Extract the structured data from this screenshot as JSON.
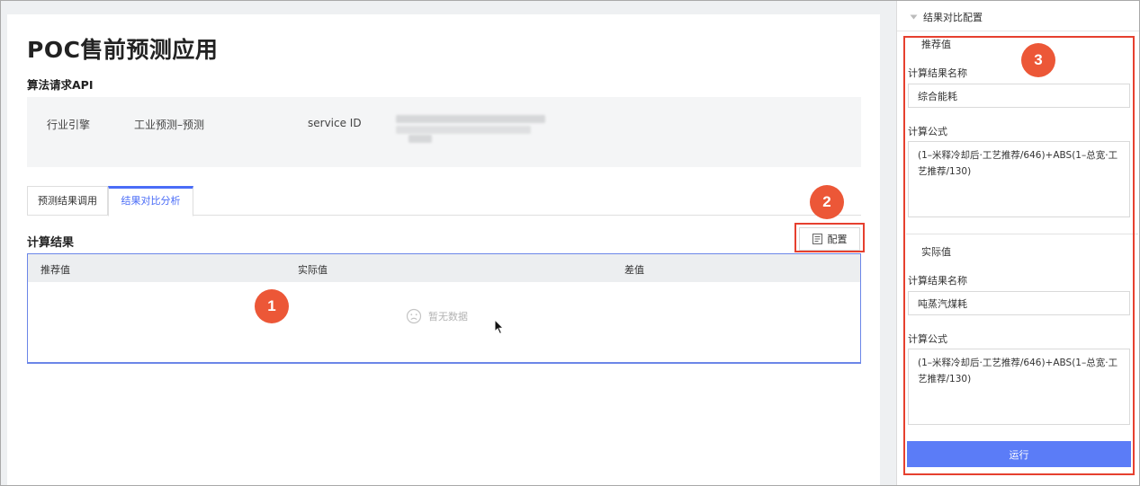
{
  "main": {
    "title": "POC售前预测应用",
    "api_section_title": "算法请求API",
    "info": {
      "engine_label": "行业引擎",
      "engine_value": "工业预测–预测",
      "service_id_label": "service ID"
    },
    "tabs": [
      {
        "label": "预测结果调用",
        "active": false
      },
      {
        "label": "结果对比分析",
        "active": true
      }
    ],
    "results_title": "计算结果",
    "config_button": "配置",
    "table": {
      "columns": [
        "推荐值",
        "实际值",
        "差值"
      ],
      "empty_text": "暂无数据"
    }
  },
  "side": {
    "header": "结果对比配置",
    "groups": [
      {
        "title": "推荐值",
        "name_label": "计算结果名称",
        "name_value": "综合能耗",
        "formula_label": "计算公式",
        "formula_value": "(1–米释冷却后·工艺推荐/646)+ABS(1–总宽·工艺推荐/130)"
      },
      {
        "title": "实际值",
        "name_label": "计算结果名称",
        "name_value": "吨蒸汽煤耗",
        "formula_label": "计算公式",
        "formula_value": "(1–米释冷却后·工艺推荐/646)+ABS(1–总宽·工艺推荐/130)"
      }
    ],
    "run_button": "运行"
  },
  "annotations": {
    "badge_1": "1",
    "badge_2": "2",
    "badge_3": "3"
  },
  "colors": {
    "accent": "#4a6cf7",
    "run_button": "#5b7cf7",
    "annotation_red": "#e6402f",
    "badge_fill": "#ec5737"
  },
  "icons": [
    "config-icon",
    "sad-face-icon",
    "caret-down-icon",
    "mouse-cursor-icon"
  ]
}
